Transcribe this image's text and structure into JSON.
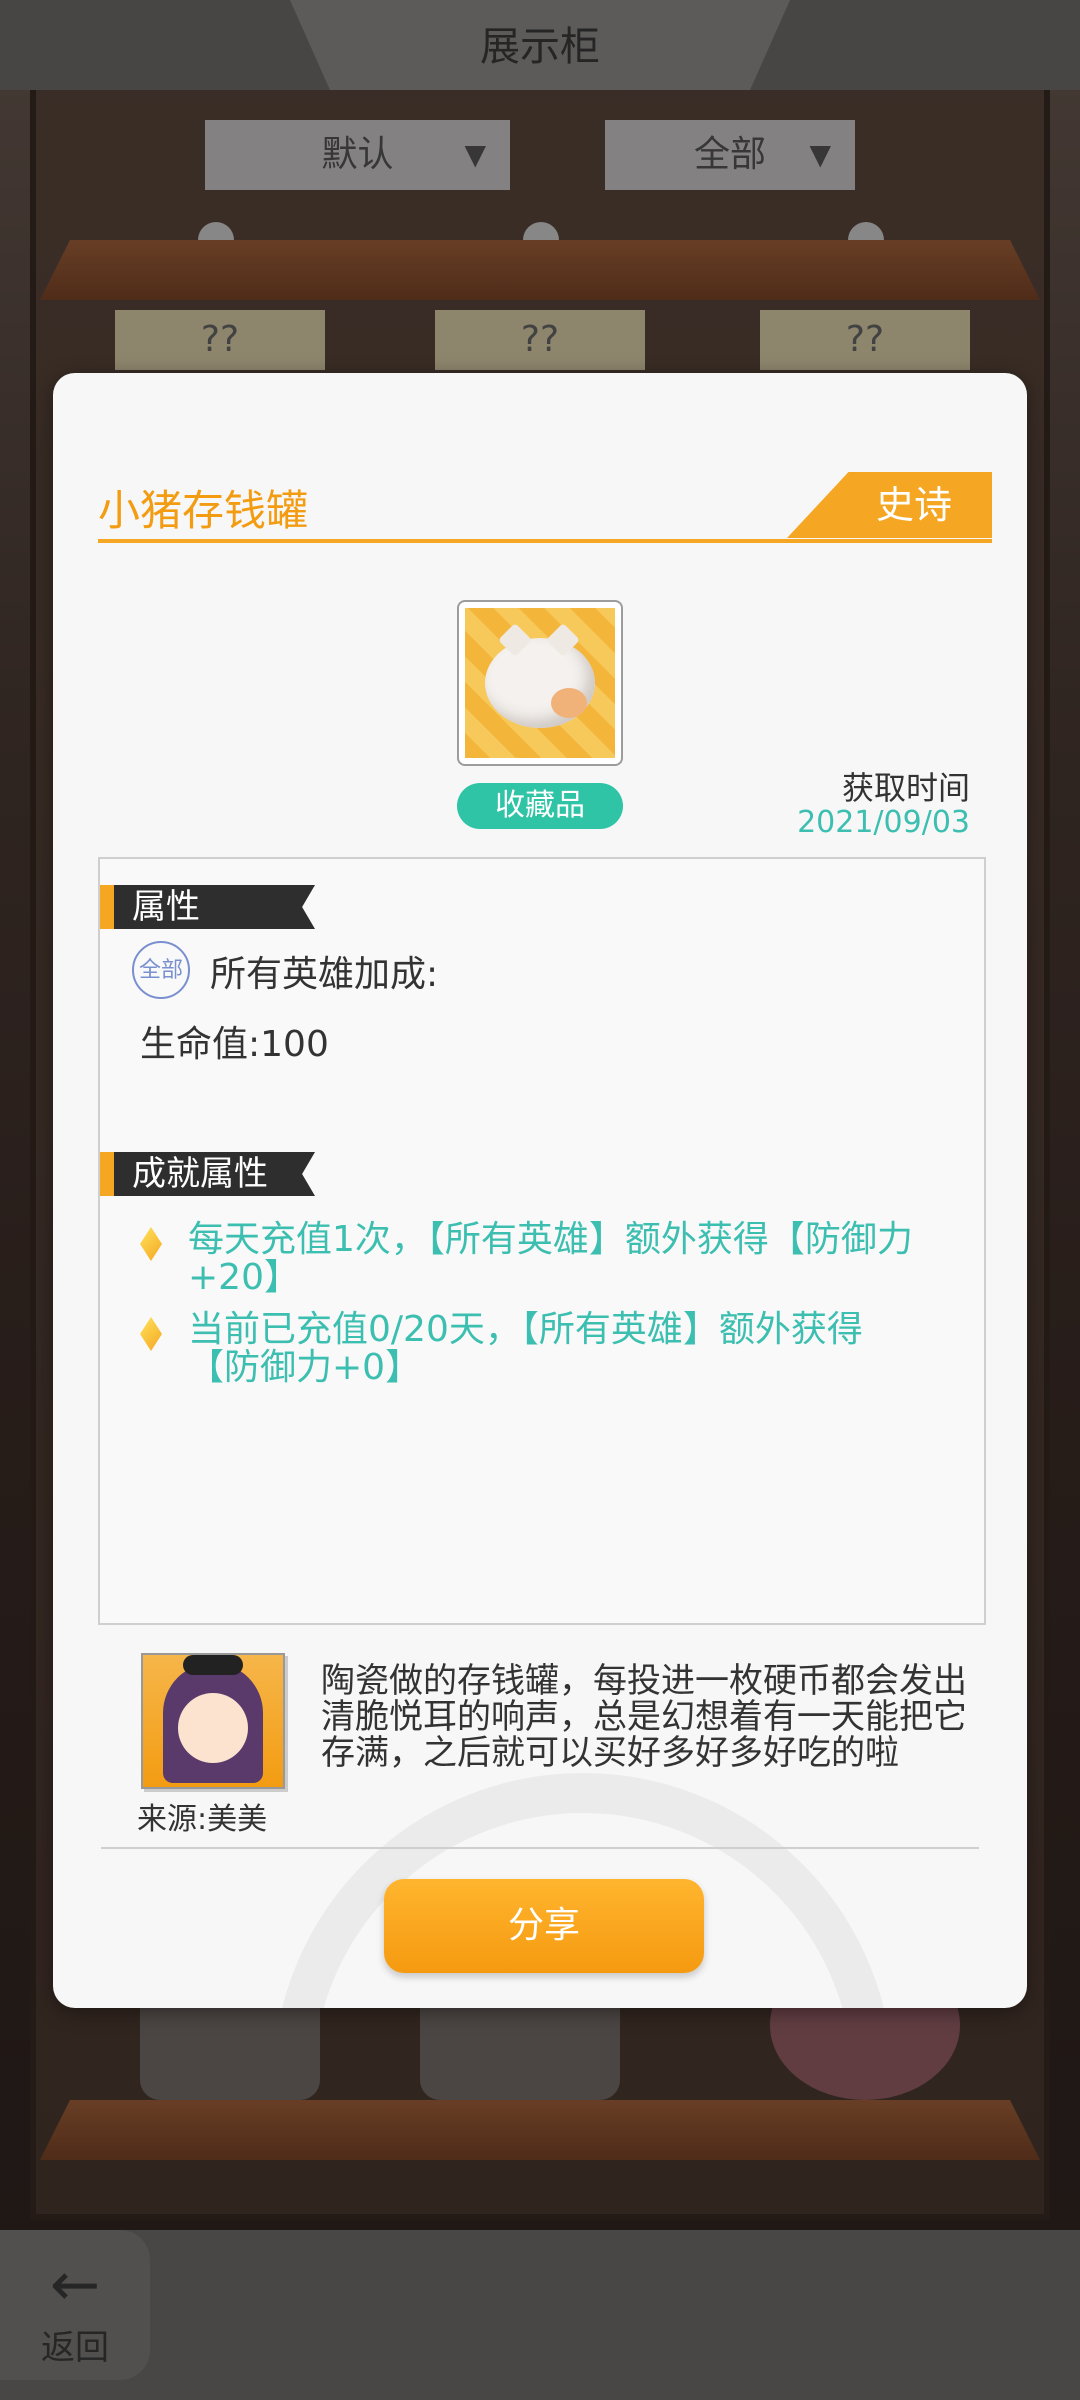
{
  "background": {
    "title": "展示柜",
    "sort_dropdown": "默认",
    "filter_dropdown": "全部",
    "shelf_placeholders": [
      "??",
      "??",
      "??"
    ],
    "back_label": "返回"
  },
  "modal": {
    "item_name": "小猪存钱罐",
    "rarity": "史诗",
    "category": "收藏品",
    "obtain_time_label": "获取时间",
    "obtain_date": "2021/09/03",
    "attributes_title": "属性",
    "scope_badge": "全部",
    "attributes_scope_text": "所有英雄加成:",
    "attribute_hp": "生命值:100",
    "achievement_title": "成就属性",
    "achievement_lines": [
      "每天充值1次，【所有英雄】额外获得【防御力+20】",
      "当前已充值0/20天，【所有英雄】额外获得【防御力+0】"
    ],
    "source_label": "来源:美美",
    "description": "陶瓷做的存钱罐，每投进一枚硬币都会发出清脆悦耳的响声，总是幻想着有一天能把它存满，之后就可以买好多好多好吃的啦",
    "share_button": "分享"
  },
  "colors": {
    "accent_orange": "#f5a623",
    "teal": "#3cbfb0",
    "badge_teal": "#2ec4a5"
  }
}
